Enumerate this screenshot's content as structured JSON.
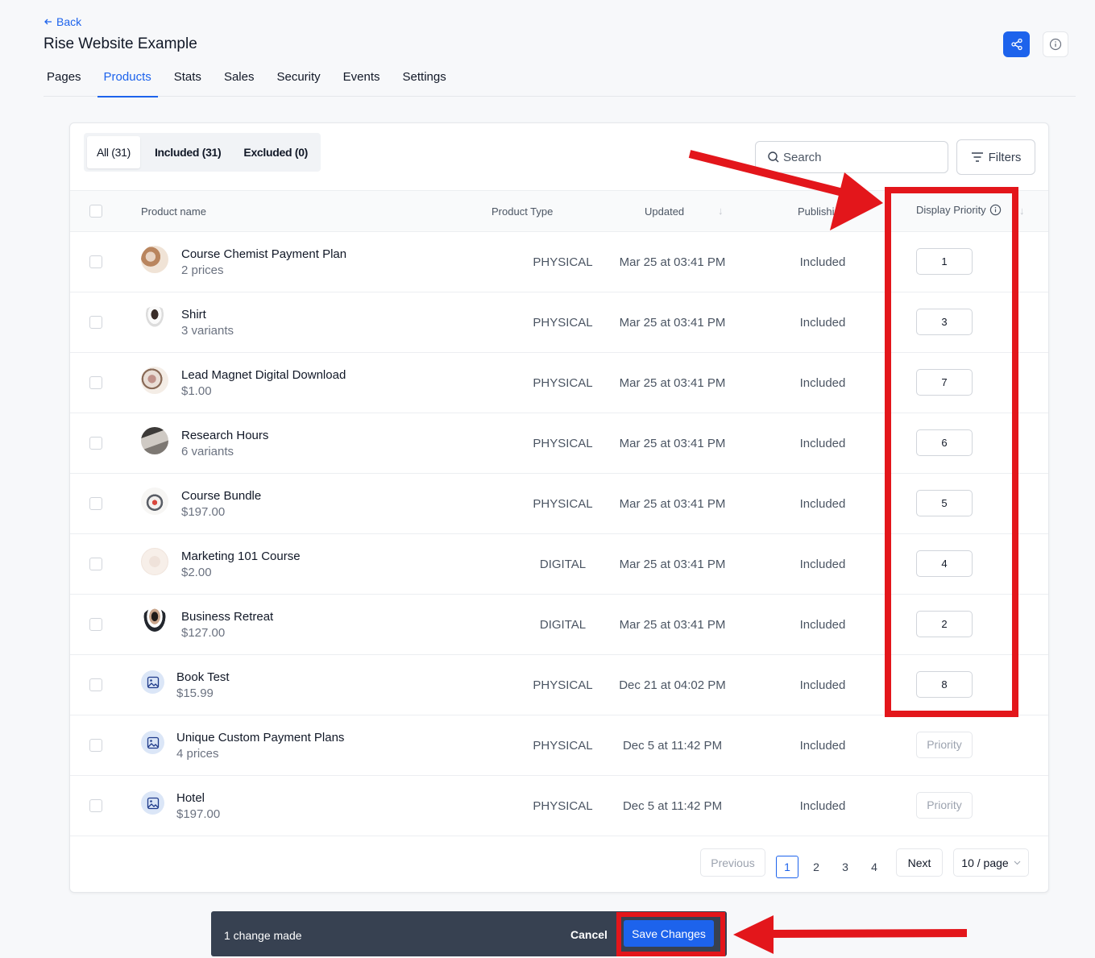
{
  "header": {
    "back_label": "Back",
    "title": "Rise Website Example"
  },
  "tabs": [
    {
      "label": "Pages"
    },
    {
      "label": "Products",
      "active": true
    },
    {
      "label": "Stats"
    },
    {
      "label": "Sales"
    },
    {
      "label": "Security"
    },
    {
      "label": "Events"
    },
    {
      "label": "Settings"
    }
  ],
  "filter_tabs": {
    "all": "All (31)",
    "included": "Included (31)",
    "excluded": "Excluded (0)"
  },
  "search": {
    "placeholder": "Search"
  },
  "filters_label": "Filters",
  "columns": {
    "name": "Product name",
    "type": "Product Type",
    "updated": "Updated",
    "publishing": "Publishing",
    "priority": "Display Priority"
  },
  "rows": [
    {
      "name": "Course Chemist Payment Plan",
      "sub": "2 prices",
      "type": "PHYSICAL",
      "updated": "Mar 25 at 03:41 PM",
      "publishing": "Included",
      "priority": "1"
    },
    {
      "name": "Shirt",
      "sub": "3 variants",
      "type": "PHYSICAL",
      "updated": "Mar 25 at 03:41 PM",
      "publishing": "Included",
      "priority": "3"
    },
    {
      "name": "Lead Magnet Digital Download",
      "sub": "$1.00",
      "type": "PHYSICAL",
      "updated": "Mar 25 at 03:41 PM",
      "publishing": "Included",
      "priority": "7"
    },
    {
      "name": "Research Hours",
      "sub": "6 variants",
      "type": "PHYSICAL",
      "updated": "Mar 25 at 03:41 PM",
      "publishing": "Included",
      "priority": "6"
    },
    {
      "name": "Course Bundle",
      "sub": "$197.00",
      "type": "PHYSICAL",
      "updated": "Mar 25 at 03:41 PM",
      "publishing": "Included",
      "priority": "5"
    },
    {
      "name": "Marketing 101 Course",
      "sub": "$2.00",
      "type": "DIGITAL",
      "updated": "Mar 25 at 03:41 PM",
      "publishing": "Included",
      "priority": "4"
    },
    {
      "name": "Business Retreat",
      "sub": "$127.00",
      "type": "DIGITAL",
      "updated": "Mar 25 at 03:41 PM",
      "publishing": "Included",
      "priority": "2"
    },
    {
      "name": "Book Test",
      "sub": "$15.99",
      "type": "PHYSICAL",
      "updated": "Dec 21 at 04:02 PM",
      "publishing": "Included",
      "priority": "8"
    },
    {
      "name": "Unique Custom Payment Plans",
      "sub": "4 prices",
      "type": "PHYSICAL",
      "updated": "Dec 5 at 11:42 PM",
      "publishing": "Included",
      "priority": ""
    },
    {
      "name": "Hotel",
      "sub": "$197.00",
      "type": "PHYSICAL",
      "updated": "Dec 5 at 11:42 PM",
      "publishing": "Included",
      "priority": ""
    }
  ],
  "priority_placeholder": "Priority",
  "pagination": {
    "previous": "Previous",
    "pages": [
      "1",
      "2",
      "3",
      "4"
    ],
    "current": "1",
    "next": "Next",
    "per_page": "10 / page"
  },
  "change_bar": {
    "message": "1 change made",
    "cancel": "Cancel",
    "save": "Save Changes"
  },
  "colors": {
    "accent": "#1d63ec",
    "annotation": "#e3161b",
    "bar": "#374151"
  }
}
